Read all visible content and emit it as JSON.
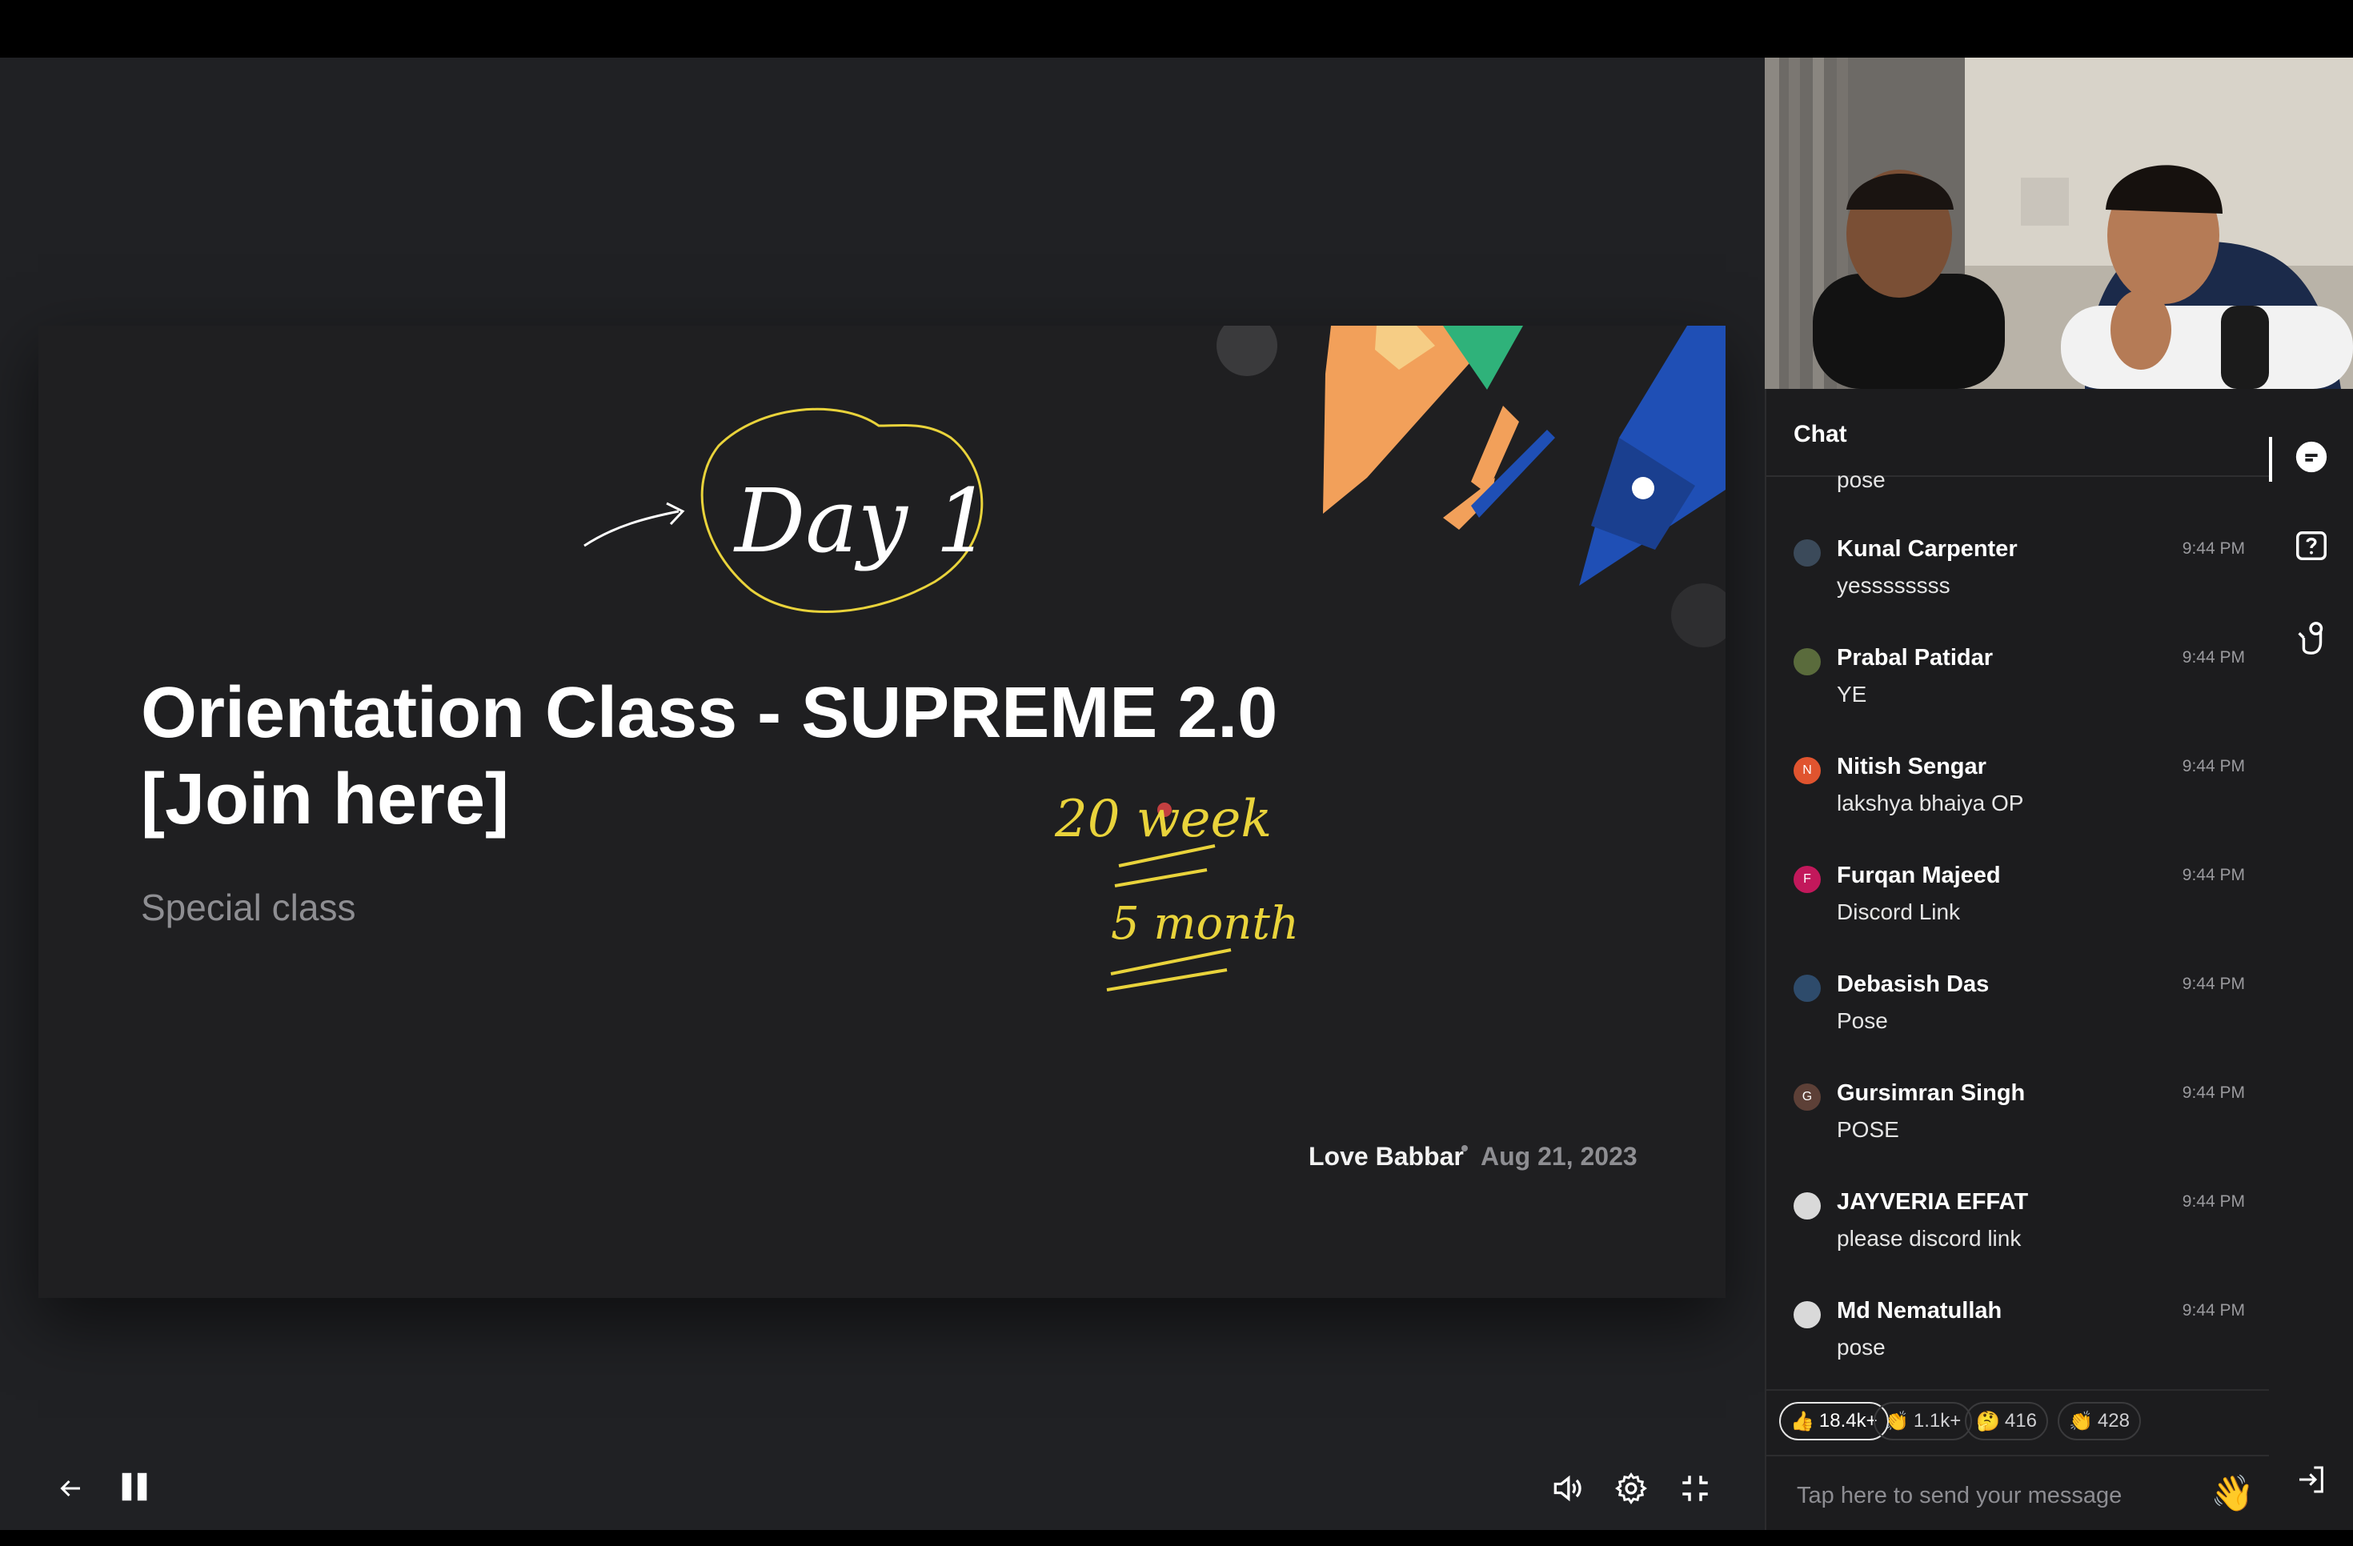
{
  "slide": {
    "title_line1": "Orientation Class - SUPREME 2.0",
    "title_line2": "[Join here]",
    "subtitle": "Special class",
    "author": "Love Babbar",
    "date": "Aug 21, 2023",
    "annotation_day": "Day 1",
    "annotation_weeks": "20 week",
    "annotation_months": "5 month"
  },
  "controls": {
    "back_icon": "arrow-left-icon",
    "pause_icon": "pause-icon",
    "volume_icon": "speaker-icon",
    "settings_icon": "gear-icon",
    "minimize_icon": "exit-fullscreen-icon"
  },
  "chat": {
    "title": "Chat",
    "partial_message": "pose",
    "messages": [
      {
        "name": "Kunal Carpenter",
        "time": "9:44 PM",
        "text": "yessssssss",
        "avatar": "",
        "color": "#3b4a5a"
      },
      {
        "name": "Prabal Patidar",
        "time": "9:44 PM",
        "text": "YE",
        "avatar": "",
        "color": "#5a6b3c"
      },
      {
        "name": "Nitish Sengar",
        "time": "9:44 PM",
        "text": "lakshya bhaiya OP",
        "avatar": "N",
        "color": "#e0542f"
      },
      {
        "name": "Furqan Majeed",
        "time": "9:44 PM",
        "text": "Discord Link",
        "avatar": "F",
        "color": "#c2185b"
      },
      {
        "name": "Debasish Das",
        "time": "9:44 PM",
        "text": "Pose",
        "avatar": "",
        "color": "#2e4b6b"
      },
      {
        "name": "Gursimran Singh",
        "time": "9:44 PM",
        "text": "POSE",
        "avatar": "G",
        "color": "#5d4037"
      },
      {
        "name": "JAYVERIA EFFAT",
        "time": "9:44 PM",
        "text": "please discord link",
        "avatar": "",
        "color": "#d9d9d9"
      },
      {
        "name": "Md Nematullah",
        "time": "9:44 PM",
        "text": "pose",
        "avatar": "",
        "color": "#d9d9d9"
      }
    ],
    "reactions": [
      {
        "emoji": "👍",
        "count": "18.4k+"
      },
      {
        "emoji": "👏",
        "count": "1.1k+"
      },
      {
        "emoji": "🤔",
        "count": "416"
      },
      {
        "emoji": "👏",
        "count": "428"
      }
    ],
    "input_placeholder": "Tap here to send your message",
    "wave_emoji": "👋"
  },
  "sidebar": {
    "icons": [
      "chat-bubble-icon",
      "question-icon",
      "raise-hand-icon",
      "leave-icon"
    ]
  }
}
